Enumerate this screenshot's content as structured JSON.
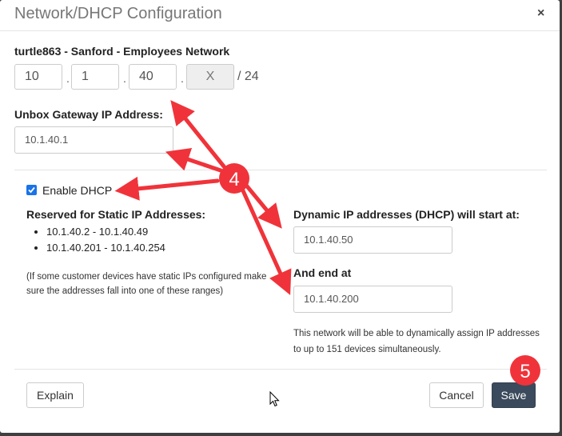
{
  "dialog": {
    "title": "Network/DHCP Configuration",
    "close_label": "×"
  },
  "network": {
    "name": "turtle863 - Sanford - Employees Network",
    "octets": [
      "10",
      "1",
      "40"
    ],
    "last_octet": "X",
    "cidr": "/ 24"
  },
  "gateway": {
    "label": "Unbox Gateway IP Address:",
    "value": "10.1.40.1"
  },
  "dhcp": {
    "enable_label": "Enable DHCP",
    "enabled": true,
    "reserved_label": "Reserved for Static IP Addresses:",
    "reserved_ranges": [
      "10.1.40.2 - 10.1.40.49",
      "10.1.40.201 - 10.1.40.254"
    ],
    "note": "(If some customer devices have static IPs configured make sure the addresses fall into one of these ranges)",
    "start_label": "Dynamic IP addresses (DHCP) will start at:",
    "start_value": "10.1.40.50",
    "end_label": "And end at",
    "end_value": "10.1.40.200",
    "info": "This network will be able to dynamically assign IP addresses to up to 151 devices simultaneously."
  },
  "footer": {
    "explain_label": "Explain",
    "cancel_label": "Cancel",
    "save_label": "Save"
  },
  "annotations": {
    "step_a": "4",
    "step_b": "5",
    "color": "#f0333a"
  }
}
